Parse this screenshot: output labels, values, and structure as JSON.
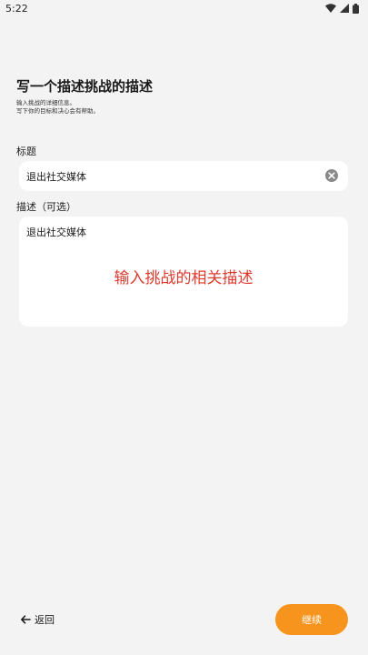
{
  "status_bar": {
    "time": "5:22"
  },
  "page": {
    "title": "写一个描述挑战的描述",
    "intro_line_1": "输入挑战的详细信息。",
    "intro_line_2": "写下你的目标和决心会有帮助。"
  },
  "title_field": {
    "label": "标题",
    "value": "退出社交媒体"
  },
  "description_field": {
    "label": "描述（可选）",
    "value": "退出社交媒体",
    "annotation": "输入挑战的相关描述"
  },
  "footer": {
    "back_label": "返回",
    "continue_label": "继续"
  },
  "colors": {
    "accent": "#f7941d",
    "annotation": "#e03a2f",
    "background": "#f3f3f3"
  }
}
